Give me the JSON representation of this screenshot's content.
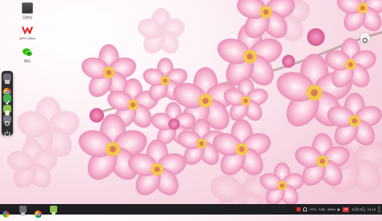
{
  "desktop": {
    "icons": [
      {
        "label": "回收站",
        "icon": "trash-icon"
      },
      {
        "label": "WPS Office",
        "icon": "wps-office-icon"
      },
      {
        "label": "微信",
        "icon": "wechat-icon"
      }
    ]
  },
  "dock": {
    "items": [
      {
        "icon": "file-manager-icon"
      },
      {
        "icon": "chrome-icon"
      },
      {
        "icon": "app-store-icon"
      },
      {
        "icon": "notes-icon"
      },
      {
        "icon": "settings-icon"
      },
      {
        "icon": "power-icon"
      }
    ]
  },
  "taskbar": {
    "start_icon": "system-menu-icon",
    "apps": [
      {
        "icon": "file-manager-icon"
      },
      {
        "icon": "chrome-icon"
      },
      {
        "icon": "notes-icon"
      }
    ],
    "tray": {
      "battery": "97%",
      "network": "12M",
      "speed": "38K/s",
      "lang": "中",
      "date": "11月19日",
      "time": "21:18"
    }
  },
  "colors": {
    "taskbar_bg": "#1f1f23",
    "dock_bg": "#2f2f33",
    "accent_red": "#e0312b",
    "blossom": "#f4a9c8"
  }
}
